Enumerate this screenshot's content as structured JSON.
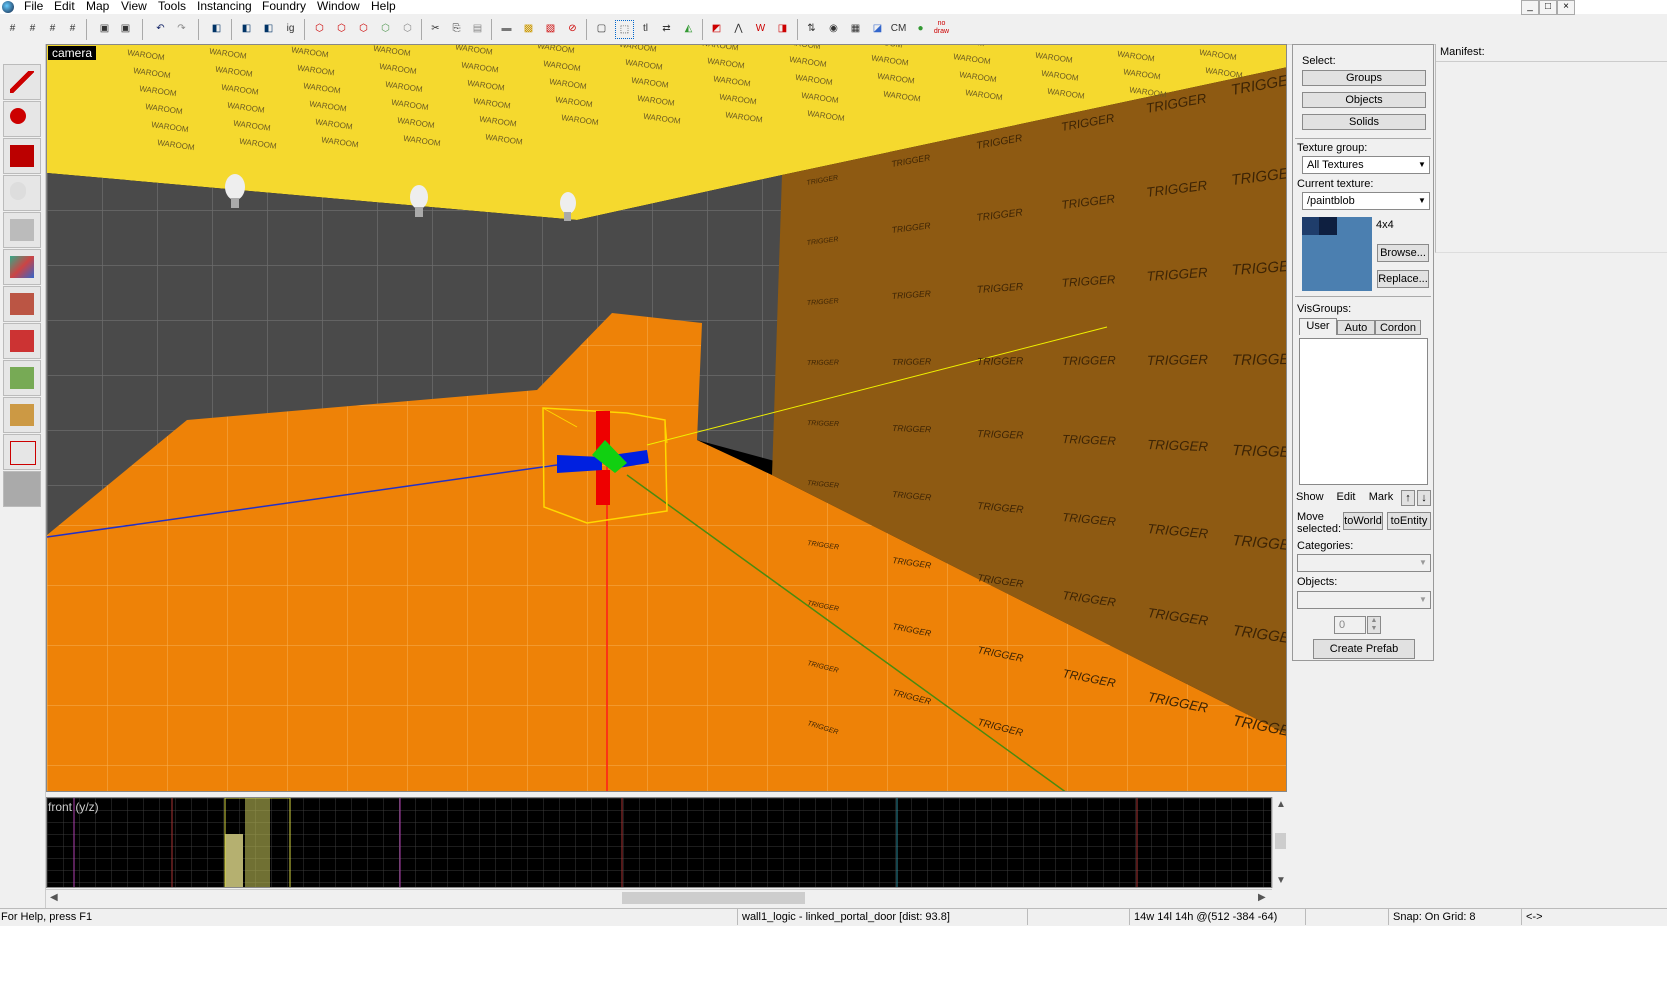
{
  "menu": [
    "File",
    "Edit",
    "Map",
    "View",
    "Tools",
    "Instancing",
    "Foundry",
    "Window",
    "Help"
  ],
  "window_controls": [
    "_",
    "□",
    "×"
  ],
  "toolbar": {
    "tl": "tl",
    "ig": "ig",
    "cm": "CM",
    "nodraw": "no draw"
  },
  "viewport3d": {
    "label": "camera",
    "ceiling_texture": "WAROOM",
    "wall_texture": "TRIGGER"
  },
  "viewport2d": {
    "label": "front (y/z)"
  },
  "panel": {
    "select_label": "Select:",
    "groups_btn": "Groups",
    "objects_btn": "Objects",
    "solids_btn": "Solids",
    "texture_group_label": "Texture group:",
    "texture_group_value": "All Textures",
    "current_texture_label": "Current texture:",
    "current_texture_value": "/paintblob",
    "texture_size": "4x4",
    "browse_btn": "Browse...",
    "replace_btn": "Replace...",
    "visgroups_label": "VisGroups:",
    "tabs": [
      "User",
      "Auto",
      "Cordon"
    ],
    "show_btn": "Show",
    "edit_btn": "Edit",
    "mark_btn": "Mark",
    "up_btn": "↑",
    "down_btn": "↓",
    "move_selected_label": "Move selected:",
    "toworld_btn": "toWorld",
    "toentity_btn": "toEntity",
    "categories_label": "Categories:",
    "objects_label": "Objects:",
    "spinner_value": "0",
    "create_prefab_btn": "Create Prefab"
  },
  "manifest": {
    "label": "Manifest:"
  },
  "status": {
    "help": "For Help, press F1",
    "selection": "wall1_logic - linked_portal_door   [dist: 93.8]",
    "size_pos": "14w 14l 14h @(512 -384 -64)",
    "snap": "Snap: On Grid: 8",
    "arrows": "<->"
  },
  "colors": {
    "floor": "#ee8207",
    "ceiling": "#f5d92e",
    "wall_dark": "#4a4a4a",
    "trigger_wall": "#8e5a12",
    "texture_swatch": "#4b7fb0"
  }
}
